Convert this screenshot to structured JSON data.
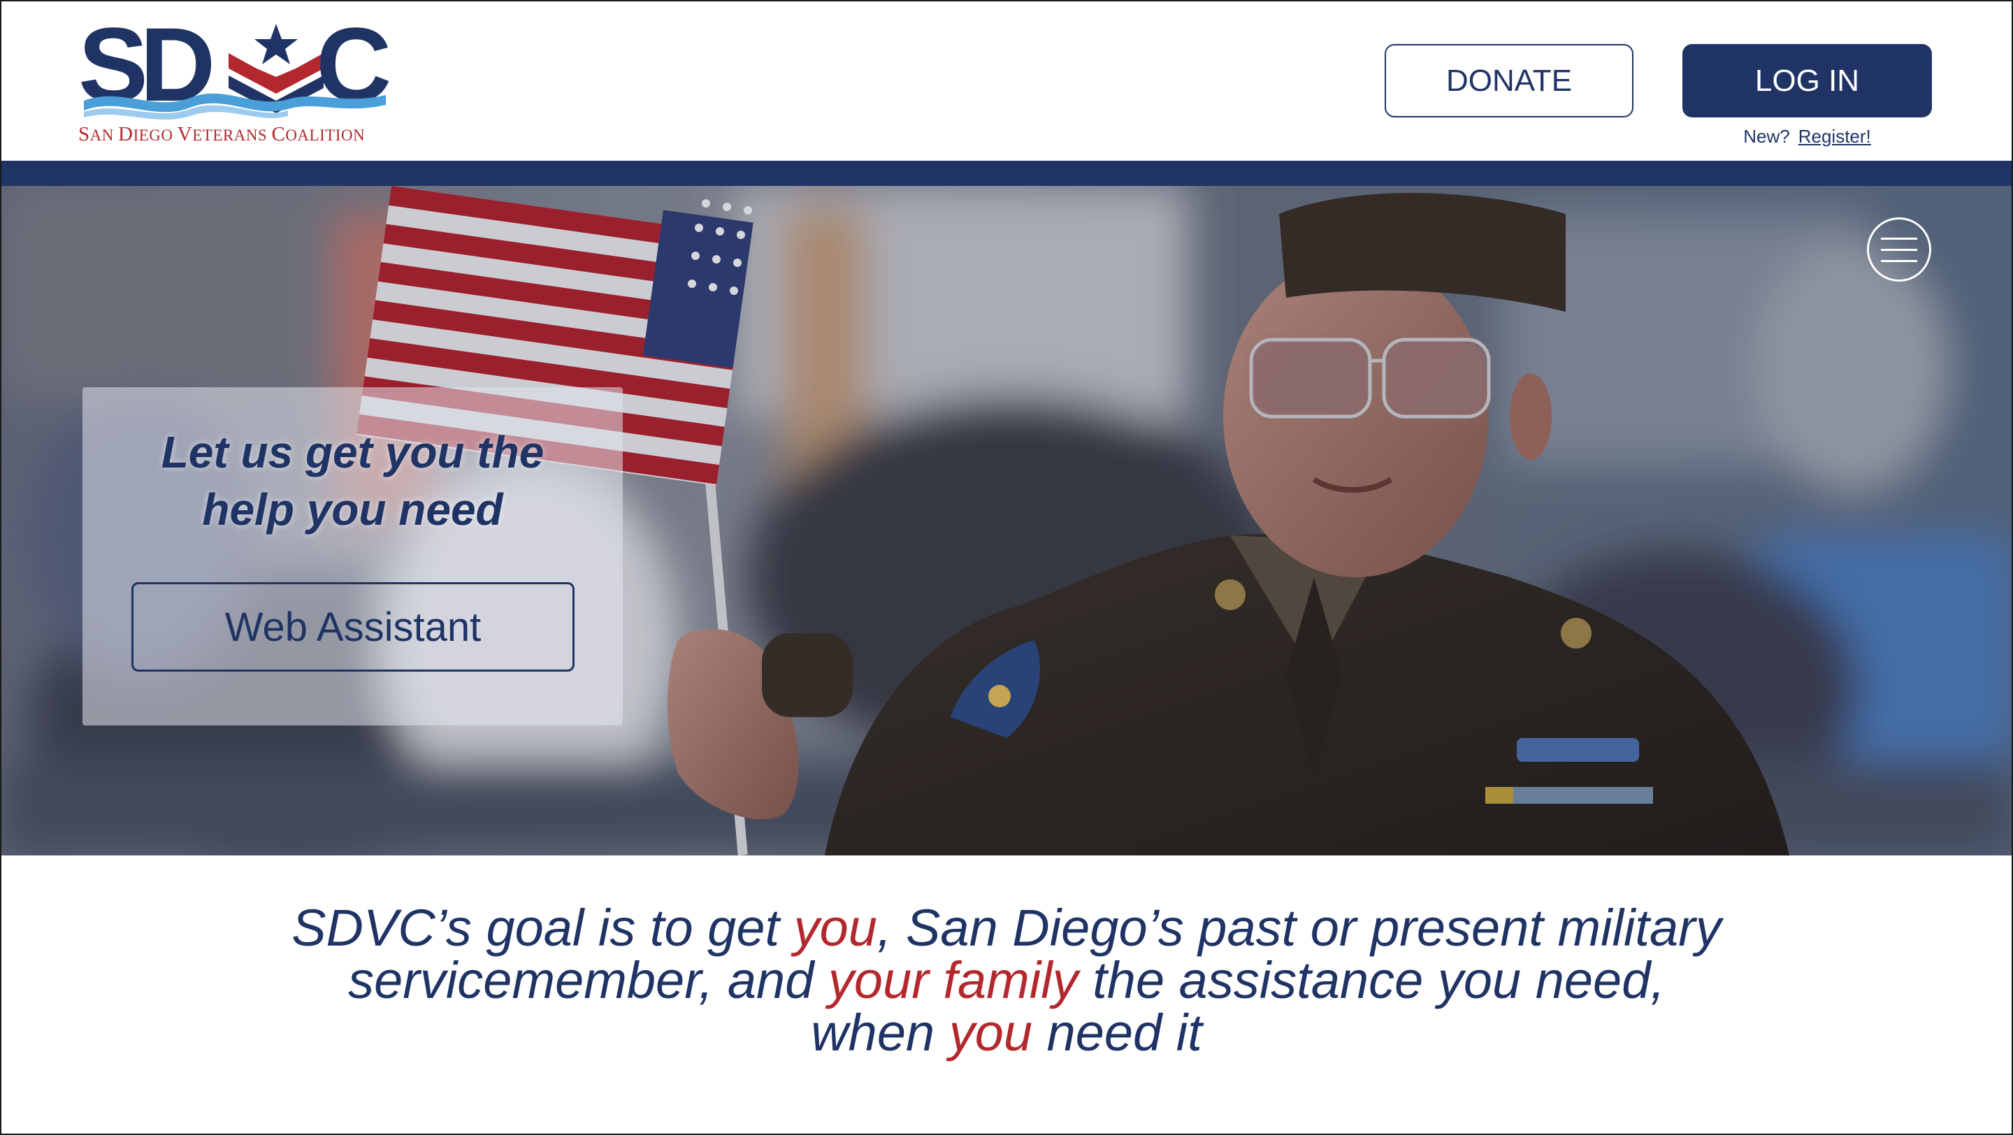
{
  "logo": {
    "letters": "SDVC",
    "tagline_parts": [
      "S",
      "AN ",
      "D",
      "IEGO ",
      "V",
      "ETERANS ",
      "C",
      "OALITION"
    ],
    "tagline": "San Diego Veterans Coalition",
    "colors": {
      "navy": "#1f3465",
      "red": "#b3282d",
      "wave": "#4a9fd8"
    }
  },
  "header": {
    "donate_label": "DONATE",
    "login_label": "LOG IN",
    "new_label": "New?",
    "register_label": "Register!"
  },
  "hero": {
    "menu_icon": "hamburger-menu-icon",
    "callout_line1": "Let us get you the",
    "callout_line2": "help you need",
    "web_assistant_label": "Web Assistant",
    "photo_subject": "veteran-with-flag-photo"
  },
  "mission": {
    "line1_a": "SDVC’s goal is to get ",
    "line1_b": "you",
    "line1_c": ", San Diego’s past or present military",
    "line2_a": "servicemember, and ",
    "line2_b": "your family",
    "line2_c": " the assistance you need,",
    "line3_a": "when ",
    "line3_b": "you",
    "line3_c": " need it"
  }
}
